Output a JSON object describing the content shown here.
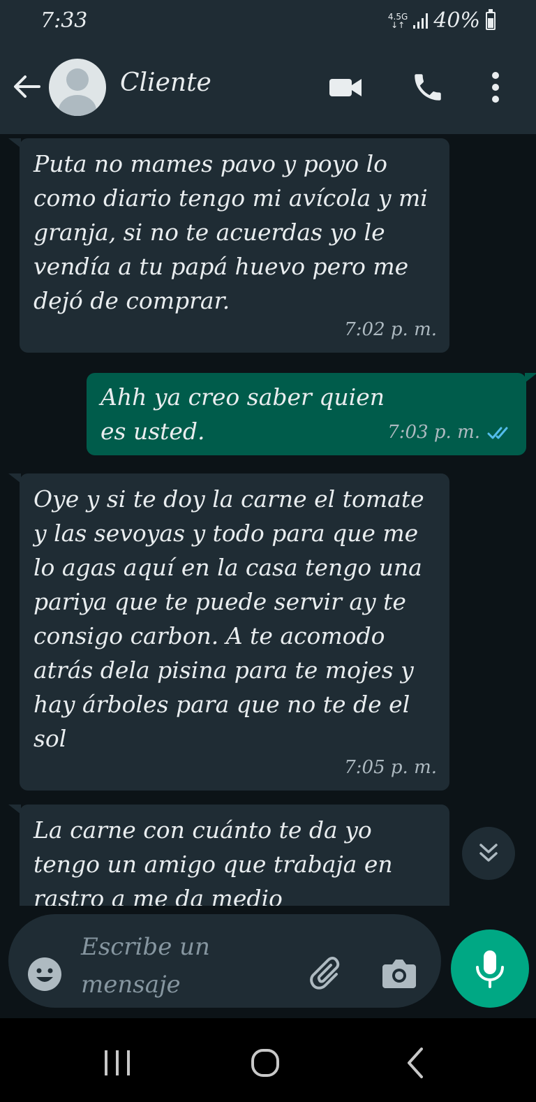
{
  "status_bar": {
    "time": "7:33",
    "network_type": "4.5G",
    "battery_percent": "40%",
    "icons": [
      "network-arrows-icon",
      "signal-icon",
      "battery-icon"
    ]
  },
  "header": {
    "contact_name": "Cliente",
    "icons": [
      "back-arrow-icon",
      "avatar-icon",
      "video-call-icon",
      "phone-icon",
      "more-vert-icon"
    ]
  },
  "messages": [
    {
      "direction": "incoming",
      "text": "Puta no mames pavo y poyo lo como diario tengo mi avícola y mi granja, si no te acuerdas yo le vendía a tu papá huevo pero me dejó de comprar.",
      "time": "7:02 p. m."
    },
    {
      "direction": "outgoing",
      "text": "Ahh ya creo saber quien es usted.",
      "time": "7:03 p. m.",
      "status": "read"
    },
    {
      "direction": "incoming",
      "text": "Oye y si te doy la carne el tomate y las sevoyas y todo para que me lo agas aquí en la casa tengo una pariya que te puede servir ay te consigo carbon. A te acomodo atrás dela pisina para te mojes y hay árboles para que no te de el sol",
      "time": "7:05 p. m."
    },
    {
      "direction": "incoming",
      "text": "La carne con cuánto te da yo tengo un amigo que trabaja en rastro a me da medio",
      "time": ""
    }
  ],
  "composer": {
    "placeholder": "Escribe un mensaje",
    "icons": [
      "emoji-icon",
      "attach-icon",
      "camera-icon",
      "mic-icon"
    ]
  },
  "colors": {
    "background": "#0c1317",
    "bar": "#1f2c34",
    "incoming_bubble": "#1f2c34",
    "outgoing_bubble": "#005c4b",
    "accent": "#00a884",
    "read_ticks": "#53bdeb"
  },
  "navigation_bar": {
    "icons": [
      "recent-apps-icon",
      "home-icon",
      "back-icon"
    ]
  }
}
